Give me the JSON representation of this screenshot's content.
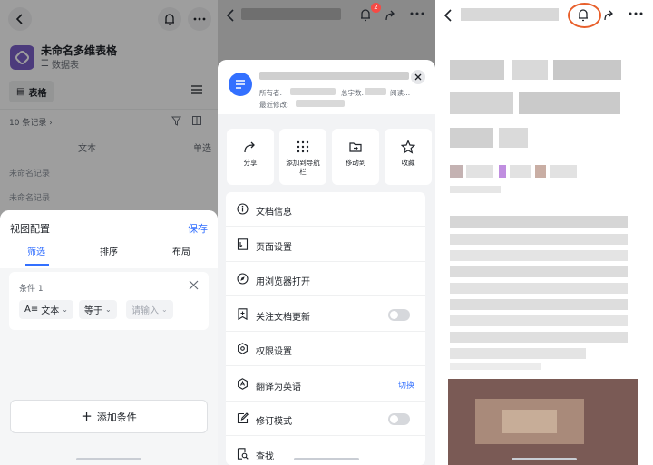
{
  "panel1": {
    "title": "未命名多维表格",
    "subtitle": "数据表",
    "table_tab": "表格",
    "record_count": "10 条记录 ›",
    "col_text": "文本",
    "col_single": "单选",
    "rows": [
      "未命名记录",
      "未命名记录"
    ],
    "sheet": {
      "title": "视图配置",
      "save": "保存",
      "tabs": [
        "筛选",
        "排序",
        "布局"
      ],
      "condition_label": "条件 1",
      "field": "文本",
      "field_prefix": "A≡",
      "operator": "等于",
      "value_placeholder": "请输入",
      "add_condition": "添加条件"
    }
  },
  "panel2": {
    "badge_count": "2",
    "meta_owner_label": "所有者:",
    "meta_words_label": "总字数:",
    "meta_read_label": "阅读...",
    "meta_modified_label": "最近修改:",
    "quick_actions": [
      "分享",
      "添加到导航栏",
      "移动到",
      "收藏"
    ],
    "menu": [
      {
        "label": "文档信息",
        "icon": "info-icon"
      },
      {
        "label": "页面设置",
        "icon": "page-settings-icon"
      },
      {
        "label": "用浏览器打开",
        "icon": "compass-icon"
      },
      {
        "label": "关注文档更新",
        "icon": "bookmark-plus-icon",
        "toggle": false
      },
      {
        "label": "权限设置",
        "icon": "gear-icon"
      },
      {
        "label": "翻译为英语",
        "icon": "translate-icon",
        "action": "切换"
      },
      {
        "label": "修订模式",
        "icon": "edit-icon",
        "toggle": false
      },
      {
        "label": "查找",
        "icon": "find-icon"
      }
    ]
  },
  "colors": {
    "accent": "#3370ff",
    "highlight_ring": "#e8602c",
    "badge": "#f54a45"
  }
}
